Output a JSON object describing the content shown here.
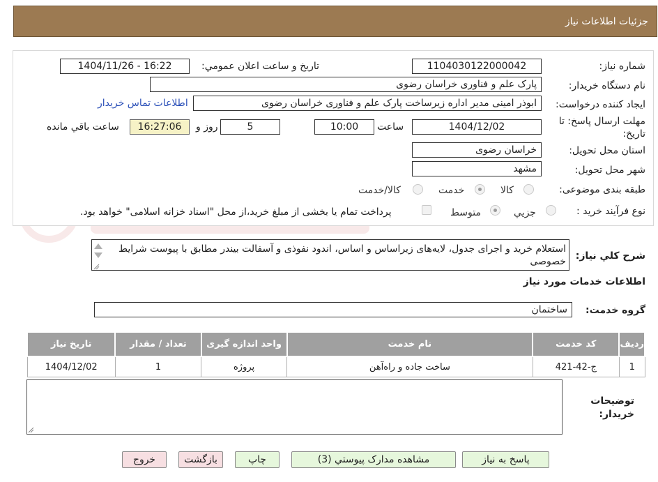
{
  "header": {
    "title": "جزئیات اطلاعات نیاز"
  },
  "form": {
    "need_number_label": "شماره نیاز:",
    "need_number": "1104030122000042",
    "announce_label": "تاریخ و ساعت اعلان عمومي:",
    "announce_value": "1404/11/26 - 16:22",
    "buyer_org_label": "نام دستگاه خریدار:",
    "buyer_org": "پارک علم و فناوری خراسان رضوی",
    "requester_label": "ایجاد کننده درخواست:",
    "requester": "ابوذر امینی مدیر اداره زیرساخت پارک علم و فناوری خراسان رضوی",
    "buyer_contact_link": "اطلاعات تماس خریدار",
    "deadline_label_1": "مهلت ارسال پاسخ: تا",
    "deadline_label_2": "تاریخ:",
    "deadline_date": "1404/12/02",
    "time_label": "ساعت",
    "deadline_time": "10:00",
    "days_value": "5",
    "days_label": "روز و",
    "remaining_time": "16:27:06",
    "remaining_label": "ساعت باقي مانده",
    "province_label": "استان محل تحویل:",
    "province": "خراسان رضوی",
    "city_label": "شهر محل تحویل:",
    "city": "مشهد",
    "category_label": "طبقه بندی موضوعی:",
    "category_options": [
      "کالا",
      "خدمت",
      "کالا/خدمت"
    ],
    "category_selected": "خدمت",
    "process_label": "نوع فرآیند خرید :",
    "process_options": [
      "جزيي",
      "متوسط"
    ],
    "process_selected": "متوسط",
    "payment_note": "پرداخت تمام یا بخشی از مبلغ خرید،از محل \"اسناد خزانه اسلامی\" خواهد بود."
  },
  "description": {
    "label": "شرح کلي نیاز:",
    "text": "استعلام خرید و اجرای جدول، لایه‌های زیراساس و اساس، اندود نفوذی و آسفالت بیندر مطابق با پیوست شرایط خصوصی"
  },
  "services": {
    "section_title": "اطلاعات خدمات مورد نیاز",
    "group_label": "گروه خدمت:",
    "group_value": "ساختمان",
    "columns": [
      "ردیف",
      "کد خدمت",
      "نام خدمت",
      "واحد اندازه گیری",
      "تعداد / مقدار",
      "تاریخ نیاز"
    ],
    "rows": [
      {
        "row": "1",
        "code": "ج-42-421",
        "name": "ساخت جاده و راه‌آهن",
        "unit": "پروژه",
        "qty": "1",
        "date": "1404/12/02"
      }
    ]
  },
  "notes": {
    "label_1": "توضیحات",
    "label_2": "خریدار:"
  },
  "buttons": {
    "reply": "پاسخ به نیاز",
    "attachments": "مشاهده مدارک پیوستي (3)",
    "print": "چاپ",
    "back": "بازگشت",
    "exit": "خروج"
  },
  "colors": {
    "header_bg": "#9c7a52",
    "table_header_bg": "#a0a0a0",
    "remaining_bg": "#f6f2c6",
    "link": "#2a4fb8"
  }
}
